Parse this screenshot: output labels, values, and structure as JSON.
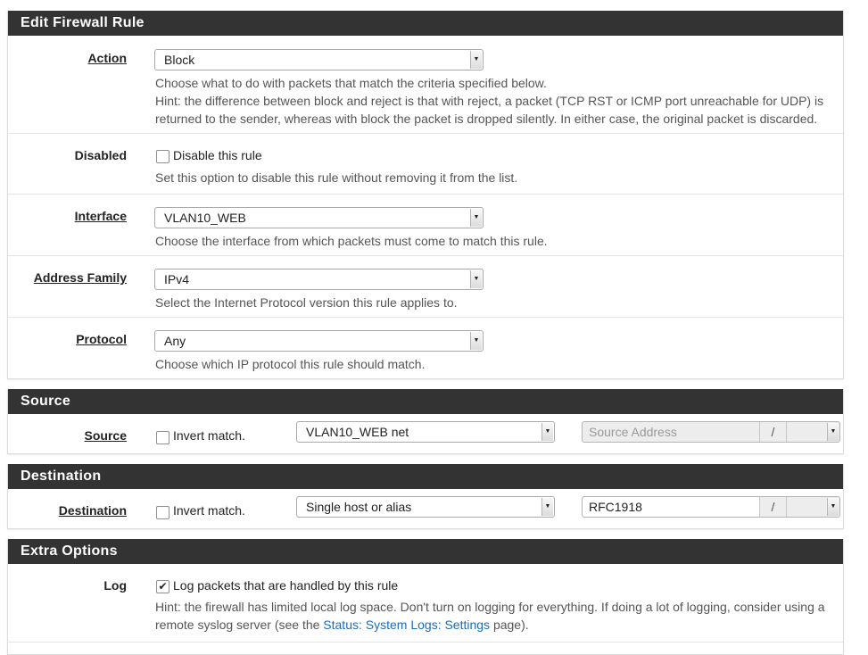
{
  "edit_rule": {
    "heading": "Edit Firewall Rule",
    "action": {
      "label": "Action",
      "value": "Block",
      "help": [
        "Choose what to do with packets that match the criteria specified below.",
        "Hint: the difference between block and reject is that with reject, a packet (TCP RST or ICMP port unreachable for UDP) is",
        "returned to the sender, whereas with block the packet is dropped silently. In either case, the original packet is discarded."
      ]
    },
    "disabled": {
      "label": "Disabled",
      "checkbox_label": "Disable this rule",
      "checked": false,
      "help": "Set this option to disable this rule without removing it from the list."
    },
    "interface": {
      "label": "Interface",
      "value": "VLAN10_WEB",
      "help": "Choose the interface from which packets must come to match this rule."
    },
    "address_family": {
      "label": "Address Family",
      "value": "IPv4",
      "help": "Select the Internet Protocol version this rule applies to."
    },
    "protocol": {
      "label": "Protocol",
      "value": "Any",
      "help": "Choose which IP protocol this rule should match."
    }
  },
  "source": {
    "heading": "Source",
    "label": "Source",
    "invert_label": "Invert match.",
    "invert_checked": false,
    "type_value": "VLAN10_WEB net",
    "address_placeholder": "Source Address",
    "slash": "/"
  },
  "destination": {
    "heading": "Destination",
    "label": "Destination",
    "invert_label": "Invert match.",
    "invert_checked": false,
    "type_value": "Single host or alias",
    "address_value": "RFC1918",
    "slash": "/"
  },
  "extra": {
    "heading": "Extra Options",
    "log": {
      "label": "Log",
      "checkbox_label": "Log packets that are handled by this rule",
      "checked": true,
      "help_line1": "Hint: the firewall has limited local log space. Don't turn on logging for everything. If doing a lot of logging, consider using a",
      "help_prefix": "remote syslog server (see the ",
      "help_link": "Status: System Logs: Settings",
      "help_suffix": " page)."
    }
  },
  "colors": {
    "heading_bg": "#333333",
    "link": "#1e6bb8"
  },
  "icons": {
    "select_arrow": "chevron-down-icon",
    "checkmark": "check-icon"
  }
}
